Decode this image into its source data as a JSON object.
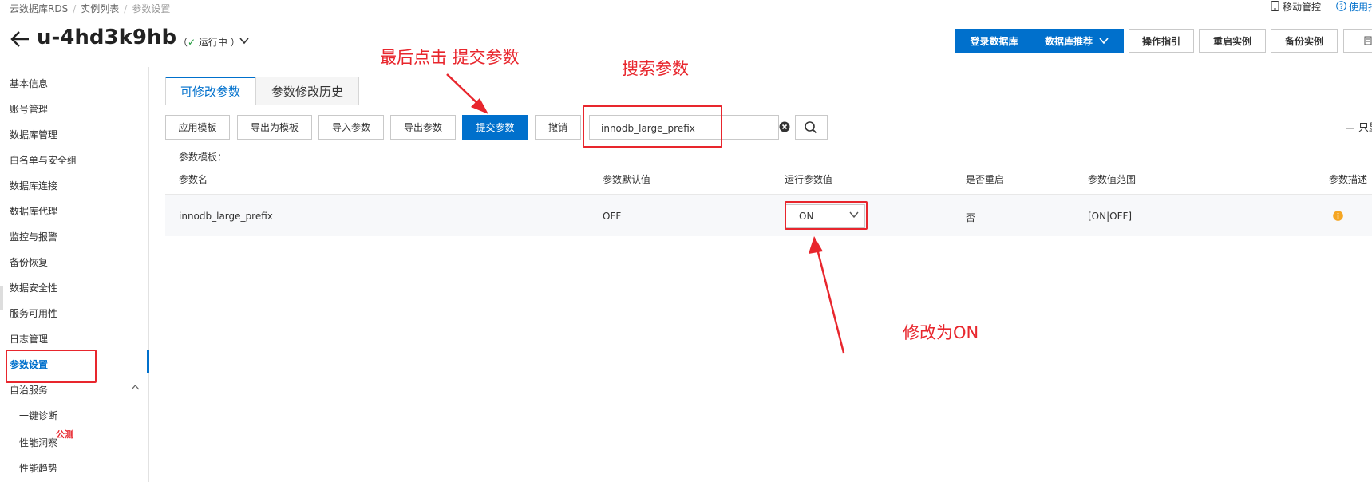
{
  "breadcrumb": [
    "云数据库RDS",
    "实例列表",
    "参数设置"
  ],
  "top_links": {
    "mobile": "移动管控",
    "usage": "使用指"
  },
  "header": {
    "title": "u-4hd3k9hb",
    "status_open": "（",
    "status_text": "运行中",
    "status_close": "）",
    "buttons": {
      "login_db": "登录数据库",
      "db_recommend": "数据库推荐",
      "guide": "操作指引",
      "restart": "重启实例",
      "backup": "备份实例"
    }
  },
  "sidebar": {
    "items": [
      "基本信息",
      "账号管理",
      "数据库管理",
      "白名单与安全组",
      "数据库连接",
      "数据库代理",
      "监控与报警",
      "备份恢复",
      "数据安全性",
      "服务可用性",
      "日志管理",
      "参数设置",
      "自治服务"
    ],
    "sub_items": [
      "一键诊断",
      "性能洞察",
      "性能趋势"
    ],
    "active": "参数设置"
  },
  "tabs": {
    "editable": "可修改参数",
    "history": "参数修改历史"
  },
  "toolbar": {
    "apply_template": "应用模板",
    "export_template": "导出为模板",
    "import_params": "导入参数",
    "export_params": "导出参数",
    "submit_params": "提交参数",
    "undo": "撤销",
    "search_value": "innodb_large_prefix",
    "readonly_label": "只显"
  },
  "table": {
    "template_label": "参数模板：",
    "headers": [
      "参数名",
      "参数默认值",
      "运行参数值",
      "是否重启",
      "参数值范围",
      "参数描述"
    ],
    "row": {
      "name": "innodb_large_prefix",
      "default": "OFF",
      "running": "ON",
      "restart": "否",
      "range": "[ON|OFF]"
    }
  },
  "annotations": {
    "submit_note": "最后点击 提交参数",
    "search_note": "搜索参数",
    "modify_note": "修改为ON",
    "beta_label": "公测"
  },
  "colors": {
    "accent": "#0070cc",
    "annotation": "#e8262d",
    "success": "#1e9a3a",
    "info": "#f5a623"
  }
}
